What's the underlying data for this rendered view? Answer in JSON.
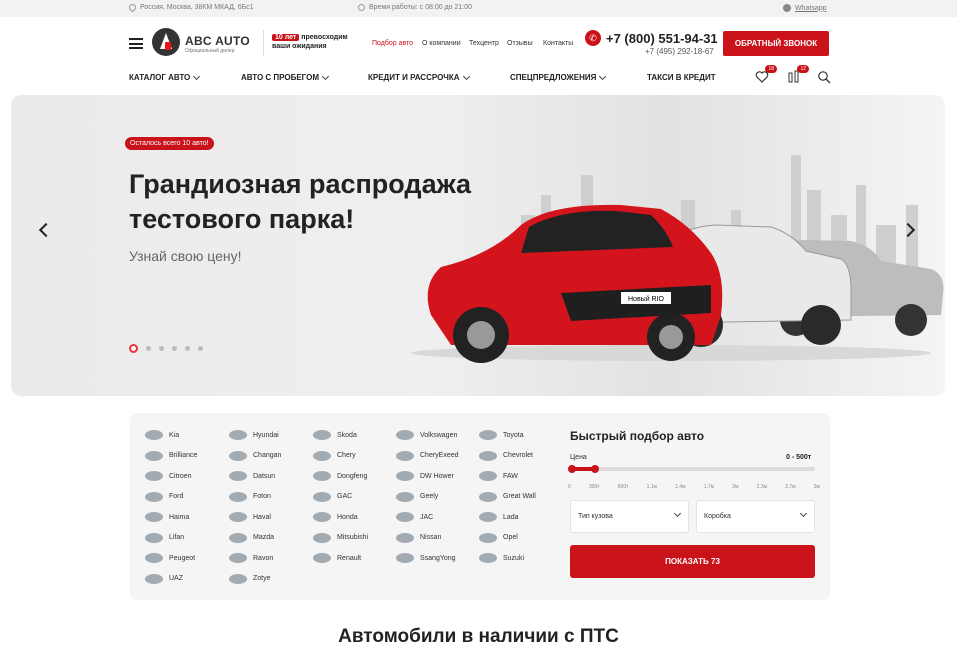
{
  "topbar": {
    "address": "Россия, Москва, 38КМ МКАД, 6Бс1",
    "hours": "Время работы: с 08:00 до 21:00",
    "whatsapp": "Whatsapp"
  },
  "header": {
    "logo_name": "ABC AUTO",
    "logo_sub": "Официальный дилер",
    "years_badge": "10 лет",
    "years_text1": "превосходим",
    "years_text2": "ваши ожидания",
    "nav": [
      "Подбор авто",
      "О компании",
      "Техцентр",
      "Отзывы",
      "Контакты"
    ],
    "nav_active_color": "#c9121a",
    "phone_main": "+7 (800) 551-94-31",
    "phone_alt": "+7 (495) 292-18-67",
    "callback_label": "ОБРАТНЫЙ ЗВОНОК"
  },
  "menu": {
    "items": [
      "КАТАЛОГ АВТО",
      "АВТО С ПРОБЕГОМ",
      "КРЕДИТ И РАССРОЧКА",
      "СПЕЦПРЕДЛОЖЕНИЯ",
      "ТАКСИ В КРЕДИТ"
    ],
    "favorites_count": "18",
    "compare_count": "12"
  },
  "hero": {
    "badge": "Осталось всего 10 авто!",
    "title": "Грандиозная распродажа тестового парка!",
    "subtitle": "Узнай свою цену!",
    "slides_count": 6,
    "active_slide": 1,
    "car_plate": "Новый RIO"
  },
  "brands": [
    [
      "Kia",
      "Hyundai",
      "Skoda",
      "Volkswagen",
      "Toyota"
    ],
    [
      "Brilliance",
      "Changan",
      "Chery",
      "CheryExeed",
      "Chevrolet"
    ],
    [
      "Citroen",
      "Datsun",
      "Dongfeng",
      "DW Hower",
      "FAW"
    ],
    [
      "Ford",
      "Foton",
      "GAC",
      "Geely",
      "Great Wall"
    ],
    [
      "Haima",
      "Haval",
      "Honda",
      "JAC",
      "Lada"
    ],
    [
      "Lifan",
      "Mazda",
      "Mitsubishi",
      "Nissan",
      "Opel"
    ],
    [
      "Peugeot",
      "Ravon",
      "Renault",
      "SsangYong",
      "Suzuki"
    ],
    [
      "UAZ",
      "Zotye"
    ]
  ],
  "filter": {
    "title": "Быстрый подбор авто",
    "price_label": "Цена",
    "price_value": "0 - 500т",
    "price_fill": 0.1,
    "ticks": [
      "0",
      "300т",
      "600т",
      "1,1м",
      "1,4м",
      "1,7м",
      "2м",
      "2,3м",
      "2,7м",
      "3м"
    ],
    "body_select": "Тип кузова",
    "gearbox_select": "Коробка",
    "show_button": "ПОКАЗАТЬ 73"
  },
  "section": {
    "title": "Автомобили в наличии с ПТС"
  }
}
